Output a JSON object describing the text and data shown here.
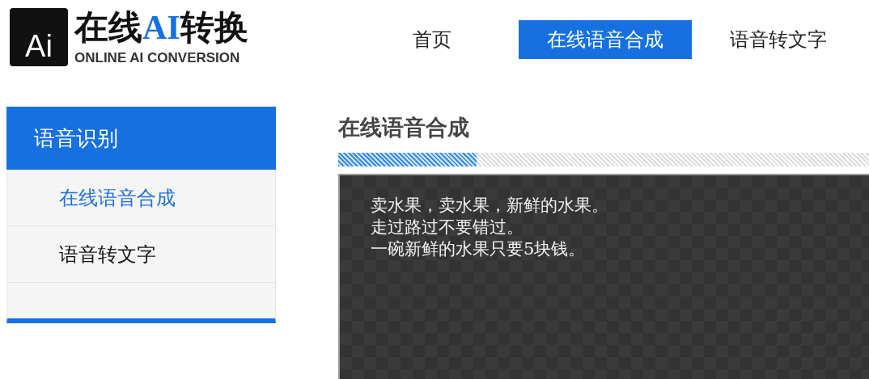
{
  "logo": {
    "mark": "Ai",
    "title": [
      {
        "text": "在线",
        "highlight": false
      },
      {
        "text": "AI",
        "highlight": true
      },
      {
        "text": "转换",
        "highlight": false
      }
    ],
    "subtitle": "ONLINE AI CONVERSION"
  },
  "nav": [
    {
      "label": "首页",
      "selected": false
    },
    {
      "label": "在线语音合成",
      "selected": true
    },
    {
      "label": "语音转文字",
      "selected": false
    }
  ],
  "sidebar": {
    "title": "语音识别",
    "items": [
      {
        "label": "在线语音合成",
        "selected": true
      },
      {
        "label": "语音转文字",
        "selected": false
      }
    ]
  },
  "main": {
    "title": "在线语音合成",
    "progress": {
      "level": 0.26
    },
    "text_lines": [
      "卖水果，卖水果，新鲜的水果。",
      "走过路过不要错过。",
      "一碗新鲜的水果只要5块钱。"
    ]
  }
}
